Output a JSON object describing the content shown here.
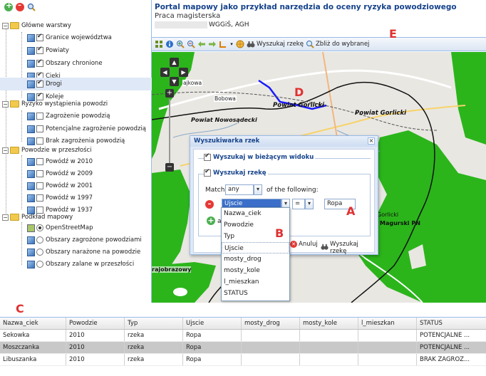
{
  "header": {
    "title": "Portal mapowy jako przykład narzędzia do oceny ryzyka powodziowego",
    "subtitle": "Praca magisterska",
    "affiliation": "WGGiŚ, AGH"
  },
  "sidebar_toolbar": {
    "icons": [
      "add-icon",
      "remove-icon",
      "zoom-icon"
    ]
  },
  "layer_tree": {
    "groups": [
      {
        "label": "Główne warstwy",
        "items": [
          {
            "label": "Granice województwa",
            "checked": true
          },
          {
            "label": "Powiaty",
            "checked": true
          },
          {
            "label": "Obszary chronione",
            "checked": true
          },
          {
            "label": "Cieki",
            "checked": true
          },
          {
            "label": "Drogi",
            "checked": true,
            "selected": true
          },
          {
            "label": "Koleje",
            "checked": true
          }
        ]
      },
      {
        "label": "Ryzyko wystąpienia powodzi",
        "items": [
          {
            "label": "Zagrożenie powodzią",
            "checked": false
          },
          {
            "label": "Potencjalne zagrożenie powodzią",
            "checked": false
          },
          {
            "label": "Brak zagrożenia powodzią",
            "checked": false
          }
        ]
      },
      {
        "label": "Powodzie w przeszłości",
        "items": [
          {
            "label": "Powódź w 2010",
            "checked": false
          },
          {
            "label": "Powódź w 2009",
            "checked": false
          },
          {
            "label": "Powódź w 2001",
            "checked": false
          },
          {
            "label": "Powódź w 1997",
            "checked": false
          },
          {
            "label": "Powódź w 1937",
            "checked": false
          }
        ]
      },
      {
        "label": "Podkład mapowy",
        "items": [
          {
            "label": "OpenStreetMap",
            "checked": true
          },
          {
            "label": "Obszary zagrożone powodziami",
            "checked": false
          },
          {
            "label": "Obszary narażone na powodzie",
            "checked": false
          },
          {
            "label": "Obszary zalane w przeszłości",
            "checked": false
          }
        ]
      }
    ]
  },
  "map_toolbar": {
    "search_river_label": "Wyszukaj rzekę",
    "zoom_selected_label": "Zbliż do wybranej"
  },
  "map": {
    "labels": {
      "powiat_gorlicki_1": "Powiat Gorlicki",
      "powiat_gorlicki_2": "Powiat Gorlicki",
      "powiat_nowosadecki": "Powiat Nowosądecki",
      "bobowa": "Bobowa",
      "gorlice_fragment": "Gorlicki",
      "magurski": "Magurski PN",
      "ajkowa": "ajkowa",
      "ajobrazowy": "rajobrazowy"
    }
  },
  "dialog": {
    "title": "Wyszukiwarka rzek",
    "search_in_view_label": "Wyszukaj w bieżącym widoku",
    "search_river_label": "Wyszukaj rzekę",
    "match_prefix": "Match",
    "match_value": "any",
    "match_suffix": "of the following:",
    "field_value": "Ujscie",
    "operator_value": "=",
    "value_value": "Ropa",
    "add_label": "a",
    "cancel_label": "Anuluj",
    "search_label": "Wyszukaj rzekę"
  },
  "dropdown_options": [
    "Nazwa_ciek",
    "Powodzie",
    "Typ",
    "Ujscie",
    "mosty_drog",
    "mosty_kole",
    "l_mieszkan",
    "STATUS"
  ],
  "annotations": {
    "a": "A",
    "b": "B",
    "c": "C",
    "d": "D",
    "e": "E"
  },
  "grid": {
    "columns": [
      "Nazwa_ciek",
      "Powodzie",
      "Typ",
      "Ujscie",
      "mosty_drog",
      "mosty_kole",
      "l_mieszkan",
      "STATUS"
    ],
    "rows": [
      [
        "Sekowka",
        "2010",
        "rzeka",
        "Ropa",
        "",
        "",
        "",
        "POTENCJALNE ..."
      ],
      [
        "Moszczanka",
        "2010",
        "rzeka",
        "Ropa",
        "",
        "",
        "",
        "POTENCJALNE ..."
      ],
      [
        "Libuszanka",
        "2010",
        "rzeka",
        "Ropa",
        "",
        "",
        "",
        "BRAK ZAGROZ..."
      ]
    ]
  },
  "colors": {
    "accent": "#15428b",
    "panel_border": "#99bbe8",
    "park_green": "#2bb51b",
    "river_blue": "#1a1aff",
    "annotation_red": "#e03131"
  }
}
